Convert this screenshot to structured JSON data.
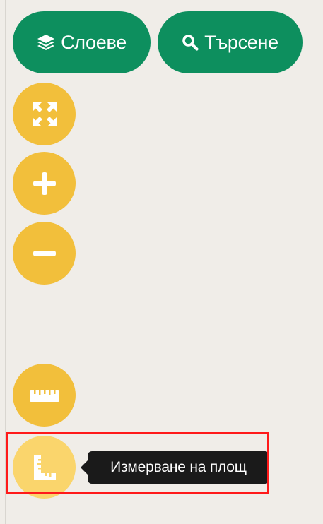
{
  "toolbar": {
    "layers_label": "Слоеве",
    "search_label": "Търсене",
    "layers_icon": "layers-icon",
    "search_icon": "search-icon",
    "button_color": "#0d8f5e"
  },
  "map_controls": {
    "button_color": "#f2bf3b",
    "active_button_color": "#fad56c",
    "buttons": [
      {
        "name": "fullscreen",
        "icon": "expand-arrows-icon"
      },
      {
        "name": "zoom-in",
        "icon": "plus-icon"
      },
      {
        "name": "zoom-out",
        "icon": "minus-icon"
      },
      {
        "name": "measure-length",
        "icon": "ruler-icon"
      },
      {
        "name": "measure-area",
        "icon": "ruler-angle-icon"
      }
    ]
  },
  "tooltip": {
    "text": "Измерване на площ",
    "background": "#1a1a1a"
  },
  "highlight": {
    "color": "#ff1a1a",
    "target": "measure-area"
  }
}
